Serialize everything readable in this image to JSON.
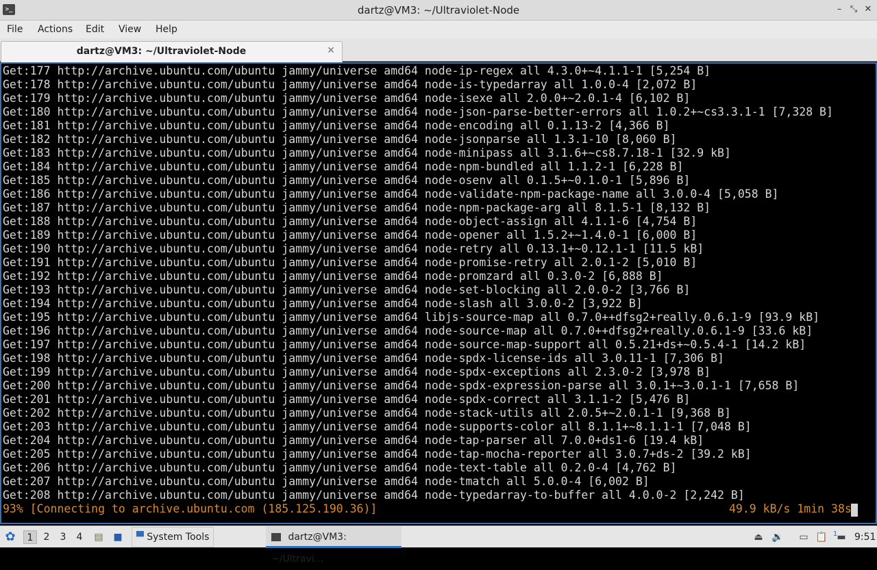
{
  "window": {
    "title": "dartz@VM3: ~/Ultraviolet-Node",
    "minimize_label": "–",
    "maximize_label": "⤡",
    "close_label": "✕"
  },
  "menu": {
    "items": [
      "File",
      "Actions",
      "Edit",
      "View",
      "Help"
    ]
  },
  "tab": {
    "label": "dartz@VM3: ~/Ultraviolet-Node",
    "close_label": "✕"
  },
  "terminal": {
    "lines": [
      "Get:177 http://archive.ubuntu.com/ubuntu jammy/universe amd64 node-ip-regex all 4.3.0+~4.1.1-1 [5,254 B]",
      "Get:178 http://archive.ubuntu.com/ubuntu jammy/universe amd64 node-is-typedarray all 1.0.0-4 [2,072 B]",
      "Get:179 http://archive.ubuntu.com/ubuntu jammy/universe amd64 node-isexe all 2.0.0+~2.0.1-4 [6,102 B]",
      "Get:180 http://archive.ubuntu.com/ubuntu jammy/universe amd64 node-json-parse-better-errors all 1.0.2+~cs3.3.1-1 [7,328 B]",
      "Get:181 http://archive.ubuntu.com/ubuntu jammy/universe amd64 node-encoding all 0.1.13-2 [4,366 B]",
      "Get:182 http://archive.ubuntu.com/ubuntu jammy/universe amd64 node-jsonparse all 1.3.1-10 [8,060 B]",
      "Get:183 http://archive.ubuntu.com/ubuntu jammy/universe amd64 node-minipass all 3.1.6+~cs8.7.18-1 [32.9 kB]",
      "Get:184 http://archive.ubuntu.com/ubuntu jammy/universe amd64 node-npm-bundled all 1.1.2-1 [6,228 B]",
      "Get:185 http://archive.ubuntu.com/ubuntu jammy/universe amd64 node-osenv all 0.1.5+~0.1.0-1 [5,896 B]",
      "Get:186 http://archive.ubuntu.com/ubuntu jammy/universe amd64 node-validate-npm-package-name all 3.0.0-4 [5,058 B]",
      "Get:187 http://archive.ubuntu.com/ubuntu jammy/universe amd64 node-npm-package-arg all 8.1.5-1 [8,132 B]",
      "Get:188 http://archive.ubuntu.com/ubuntu jammy/universe amd64 node-object-assign all 4.1.1-6 [4,754 B]",
      "Get:189 http://archive.ubuntu.com/ubuntu jammy/universe amd64 node-opener all 1.5.2+~1.4.0-1 [6,000 B]",
      "Get:190 http://archive.ubuntu.com/ubuntu jammy/universe amd64 node-retry all 0.13.1+~0.12.1-1 [11.5 kB]",
      "Get:191 http://archive.ubuntu.com/ubuntu jammy/universe amd64 node-promise-retry all 2.0.1-2 [5,010 B]",
      "Get:192 http://archive.ubuntu.com/ubuntu jammy/universe amd64 node-promzard all 0.3.0-2 [6,888 B]",
      "Get:193 http://archive.ubuntu.com/ubuntu jammy/universe amd64 node-set-blocking all 2.0.0-2 [3,766 B]",
      "Get:194 http://archive.ubuntu.com/ubuntu jammy/universe amd64 node-slash all 3.0.0-2 [3,922 B]",
      "Get:195 http://archive.ubuntu.com/ubuntu jammy/universe amd64 libjs-source-map all 0.7.0++dfsg2+really.0.6.1-9 [93.9 kB]",
      "Get:196 http://archive.ubuntu.com/ubuntu jammy/universe amd64 node-source-map all 0.7.0++dfsg2+really.0.6.1-9 [33.6 kB]",
      "Get:197 http://archive.ubuntu.com/ubuntu jammy/universe amd64 node-source-map-support all 0.5.21+ds+~0.5.4-1 [14.2 kB]",
      "Get:198 http://archive.ubuntu.com/ubuntu jammy/universe amd64 node-spdx-license-ids all 3.0.11-1 [7,306 B]",
      "Get:199 http://archive.ubuntu.com/ubuntu jammy/universe amd64 node-spdx-exceptions all 2.3.0-2 [3,978 B]",
      "Get:200 http://archive.ubuntu.com/ubuntu jammy/universe amd64 node-spdx-expression-parse all 3.0.1+~3.0.1-1 [7,658 B]",
      "Get:201 http://archive.ubuntu.com/ubuntu jammy/universe amd64 node-spdx-correct all 3.1.1-2 [5,476 B]",
      "Get:202 http://archive.ubuntu.com/ubuntu jammy/universe amd64 node-stack-utils all 2.0.5+~2.0.1-1 [9,368 B]",
      "Get:203 http://archive.ubuntu.com/ubuntu jammy/universe amd64 node-supports-color all 8.1.1+~8.1.1-1 [7,048 B]",
      "Get:204 http://archive.ubuntu.com/ubuntu jammy/universe amd64 node-tap-parser all 7.0.0+ds1-6 [19.4 kB]",
      "Get:205 http://archive.ubuntu.com/ubuntu jammy/universe amd64 node-tap-mocha-reporter all 3.0.7+ds-2 [39.2 kB]",
      "Get:206 http://archive.ubuntu.com/ubuntu jammy/universe amd64 node-text-table all 0.2.0-4 [4,762 B]",
      "Get:207 http://archive.ubuntu.com/ubuntu jammy/universe amd64 node-tmatch all 5.0.0-4 [6,002 B]",
      "Get:208 http://archive.ubuntu.com/ubuntu jammy/universe amd64 node-typedarray-to-buffer all 4.0.0-2 [2,242 B]"
    ],
    "status_left": "93% [Connecting to archive.ubuntu.com (185.125.190.36)]",
    "status_right": "49.9 kB/s 1min 38s",
    "status_color": "#d98a2a"
  },
  "taskbar": {
    "start_icon": "lubuntu-start-icon",
    "workspaces": [
      "1",
      "2",
      "3",
      "4"
    ],
    "active_workspace": "1",
    "system_tools_label": "System Tools",
    "task_label": "dartz@VM3: ~/Ultravi...",
    "notification_count": "1",
    "clock": "9:51"
  }
}
